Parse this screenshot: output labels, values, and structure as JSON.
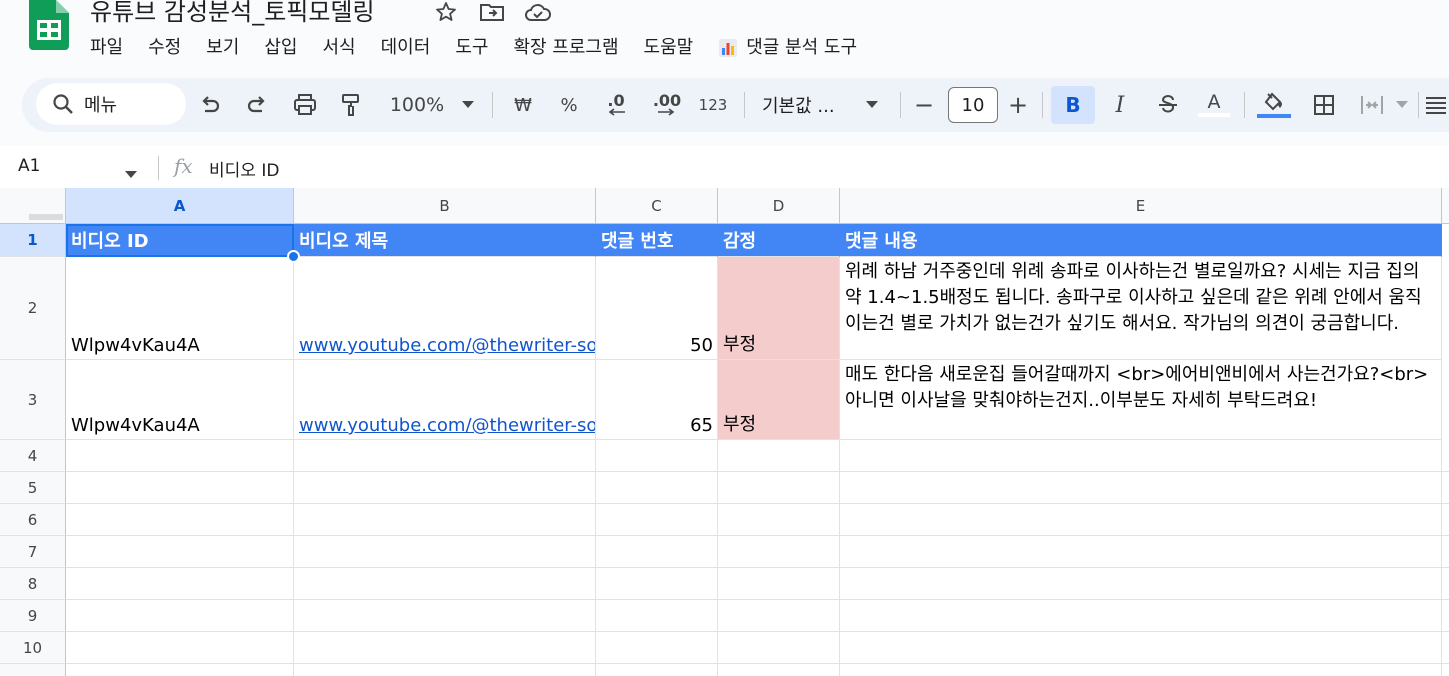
{
  "doc": {
    "title": "유튜브 감성분석_토픽모델링"
  },
  "menu": {
    "items": [
      "파일",
      "수정",
      "보기",
      "삽입",
      "서식",
      "데이터",
      "도구",
      "확장 프로그램",
      "도움말"
    ],
    "extension_label": "댓글 분석 도구"
  },
  "toolbar": {
    "search_label": "메뉴",
    "zoom": "100%",
    "currency": "₩",
    "percent": "%",
    "dec_decrease": ".0",
    "dec_increase": ".00",
    "number_format": "123",
    "font_name": "기본값 ...",
    "font_size": "10",
    "minus": "−",
    "plus": "+",
    "bold": "B",
    "italic": "I",
    "text_color": "A"
  },
  "formula": {
    "cell_ref": "A1",
    "fx": "fx",
    "value": "비디오 ID"
  },
  "sheet": {
    "columns": [
      "A",
      "B",
      "C",
      "D",
      "E"
    ],
    "rows": [
      "1",
      "2",
      "3",
      "4",
      "5",
      "6",
      "7",
      "8",
      "9",
      "10"
    ],
    "header": [
      "비디오 ID",
      "비디오 제목",
      "댓글 번호",
      "감정",
      "댓글 내용"
    ],
    "data": [
      {
        "video_id": "Wlpw4vKau4A",
        "title": "www.youtube.com/@thewriter-sonsoon",
        "num": "50",
        "sentiment": "부정",
        "comment": "위례 하남 거주중인데 위례 송파로 이사하는건 별로일까요? 시세는 지금 집의 약 1.4~1.5배정도 됩니다. 송파구로 이사하고 싶은데 같은 위례 안에서 움직이는건 별로 가치가 없는건가 싶기도 해서요. 작가님의 의견이 궁금합니다."
      },
      {
        "video_id": "Wlpw4vKau4A",
        "title": "www.youtube.com/@thewriter-sonsoon",
        "num": "65",
        "sentiment": "부정",
        "comment": "매도 한다음 새로운집 들어갈때까지 <br>에어비앤비에서 사는건가요?<br>아니면 이사날을 맞춰야하는건지..이부분도 자세히 부탁드려요!"
      }
    ]
  },
  "colors": {
    "header_blue": "#4285f4",
    "negative_fill": "#f4cccc",
    "link": "#1155cc",
    "selection": "#1a73e8"
  }
}
